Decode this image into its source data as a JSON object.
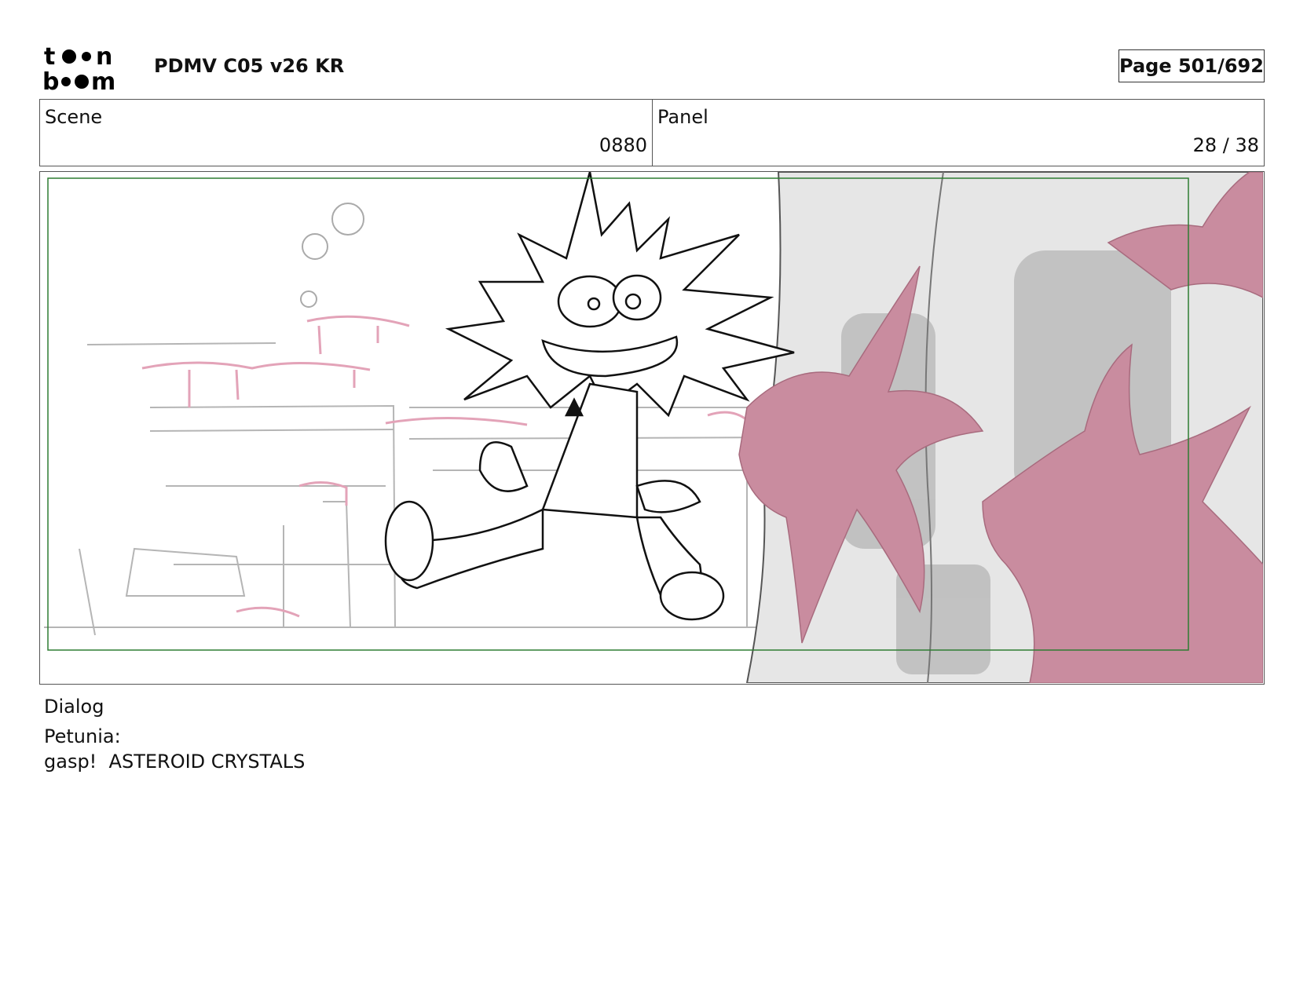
{
  "header": {
    "logo_icon": "toon-boom-logo-icon",
    "title": "PDMV C05 v26 KR",
    "page": "Page 501/692"
  },
  "scene": {
    "label": "Scene",
    "value": "0880"
  },
  "panel": {
    "label": "Panel",
    "value": "28 / 38"
  },
  "artwork": {
    "safe_frame_color": "#2e7d32",
    "goo_color": "#c98c9f",
    "wall_color": "#e6e6e6"
  },
  "dialog": {
    "label": "Dialog",
    "speaker": "Petunia:",
    "line": "gasp!  ASTEROID CRYSTALS"
  }
}
